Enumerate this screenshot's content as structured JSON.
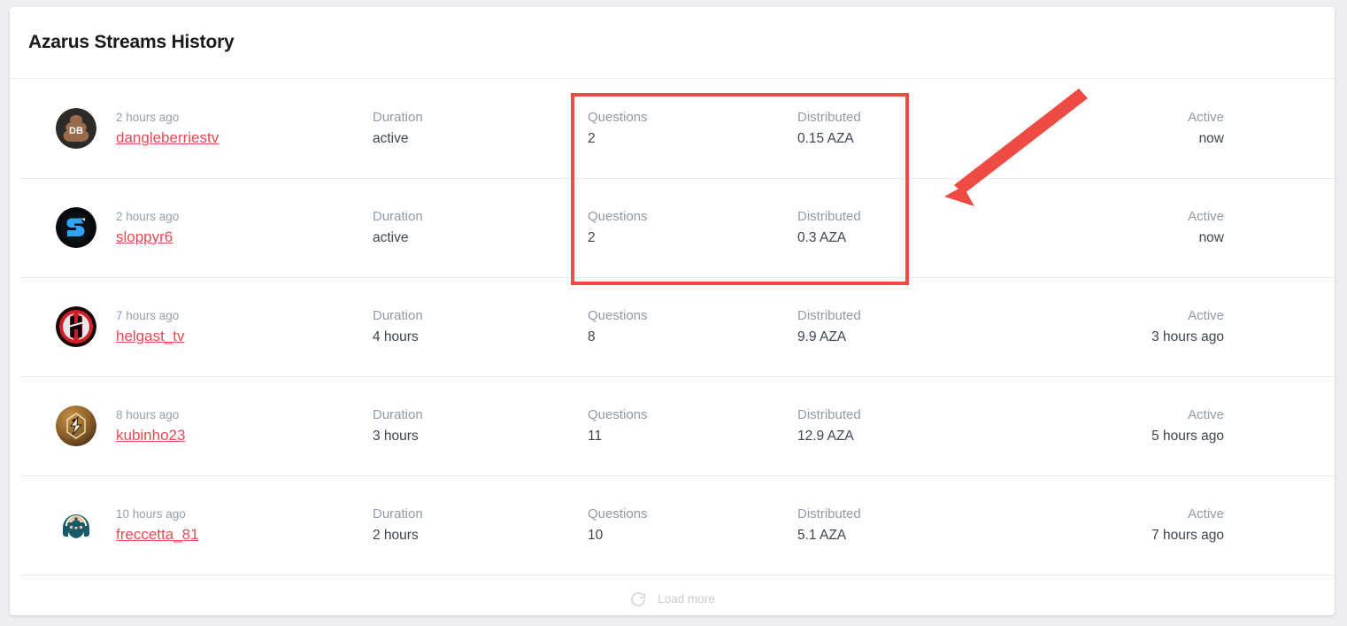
{
  "header": {
    "title": "Azarus Streams History"
  },
  "columns": {
    "duration_label": "Duration",
    "questions_label": "Questions",
    "distributed_label": "Distributed",
    "active_label": "Active"
  },
  "rows": [
    {
      "ago": "2 hours ago",
      "username": "dangleberriestv",
      "duration_label": "Duration",
      "duration": "active",
      "questions_label": "Questions",
      "questions": "2",
      "distributed_label": "Distributed",
      "distributed": "0.15 AZA",
      "active_label": "Active",
      "active": "now",
      "avatar": "dangleberriestv-avatar"
    },
    {
      "ago": "2 hours ago",
      "username": "sloppyr6",
      "duration_label": "Duration",
      "duration": "active",
      "questions_label": "Questions",
      "questions": "2",
      "distributed_label": "Distributed",
      "distributed": "0.3 AZA",
      "active_label": "Active",
      "active": "now",
      "avatar": "sloppyr6-avatar"
    },
    {
      "ago": "7 hours ago",
      "username": "helgast_tv",
      "duration_label": "Duration",
      "duration": "4 hours",
      "questions_label": "Questions",
      "questions": "8",
      "distributed_label": "Distributed",
      "distributed": "9.9 AZA",
      "active_label": "Active",
      "active": "3 hours ago",
      "avatar": "helgast_tv-avatar"
    },
    {
      "ago": "8 hours ago",
      "username": "kubinho23",
      "duration_label": "Duration",
      "duration": "3 hours",
      "questions_label": "Questions",
      "questions": "11",
      "distributed_label": "Distributed",
      "distributed": "12.9 AZA",
      "active_label": "Active",
      "active": "5 hours ago",
      "avatar": "kubinho23-avatar"
    },
    {
      "ago": "10 hours ago",
      "username": "freccetta_81",
      "duration_label": "Duration",
      "duration": "2 hours",
      "questions_label": "Questions",
      "questions": "10",
      "distributed_label": "Distributed",
      "distributed": "5.1 AZA",
      "active_label": "Active",
      "active": "7 hours ago",
      "avatar": "freccetta_81-avatar"
    }
  ],
  "footer": {
    "load_more_label": "Load more",
    "refresh_icon": "refresh-icon"
  },
  "annotations": {
    "highlight_box_color": "#ee4b45",
    "arrow_color": "#ee4b45",
    "highlight_box_name": "questions-distributed-highlight",
    "arrow_name": "pointer-arrow"
  },
  "colors": {
    "page_background": "#eceef2",
    "card_background": "#ffffff",
    "link": "#e94a53",
    "muted_label": "#8e9aaa",
    "value_text": "#3c4452",
    "title": "#18191a",
    "divider": "#e9ebef"
  }
}
